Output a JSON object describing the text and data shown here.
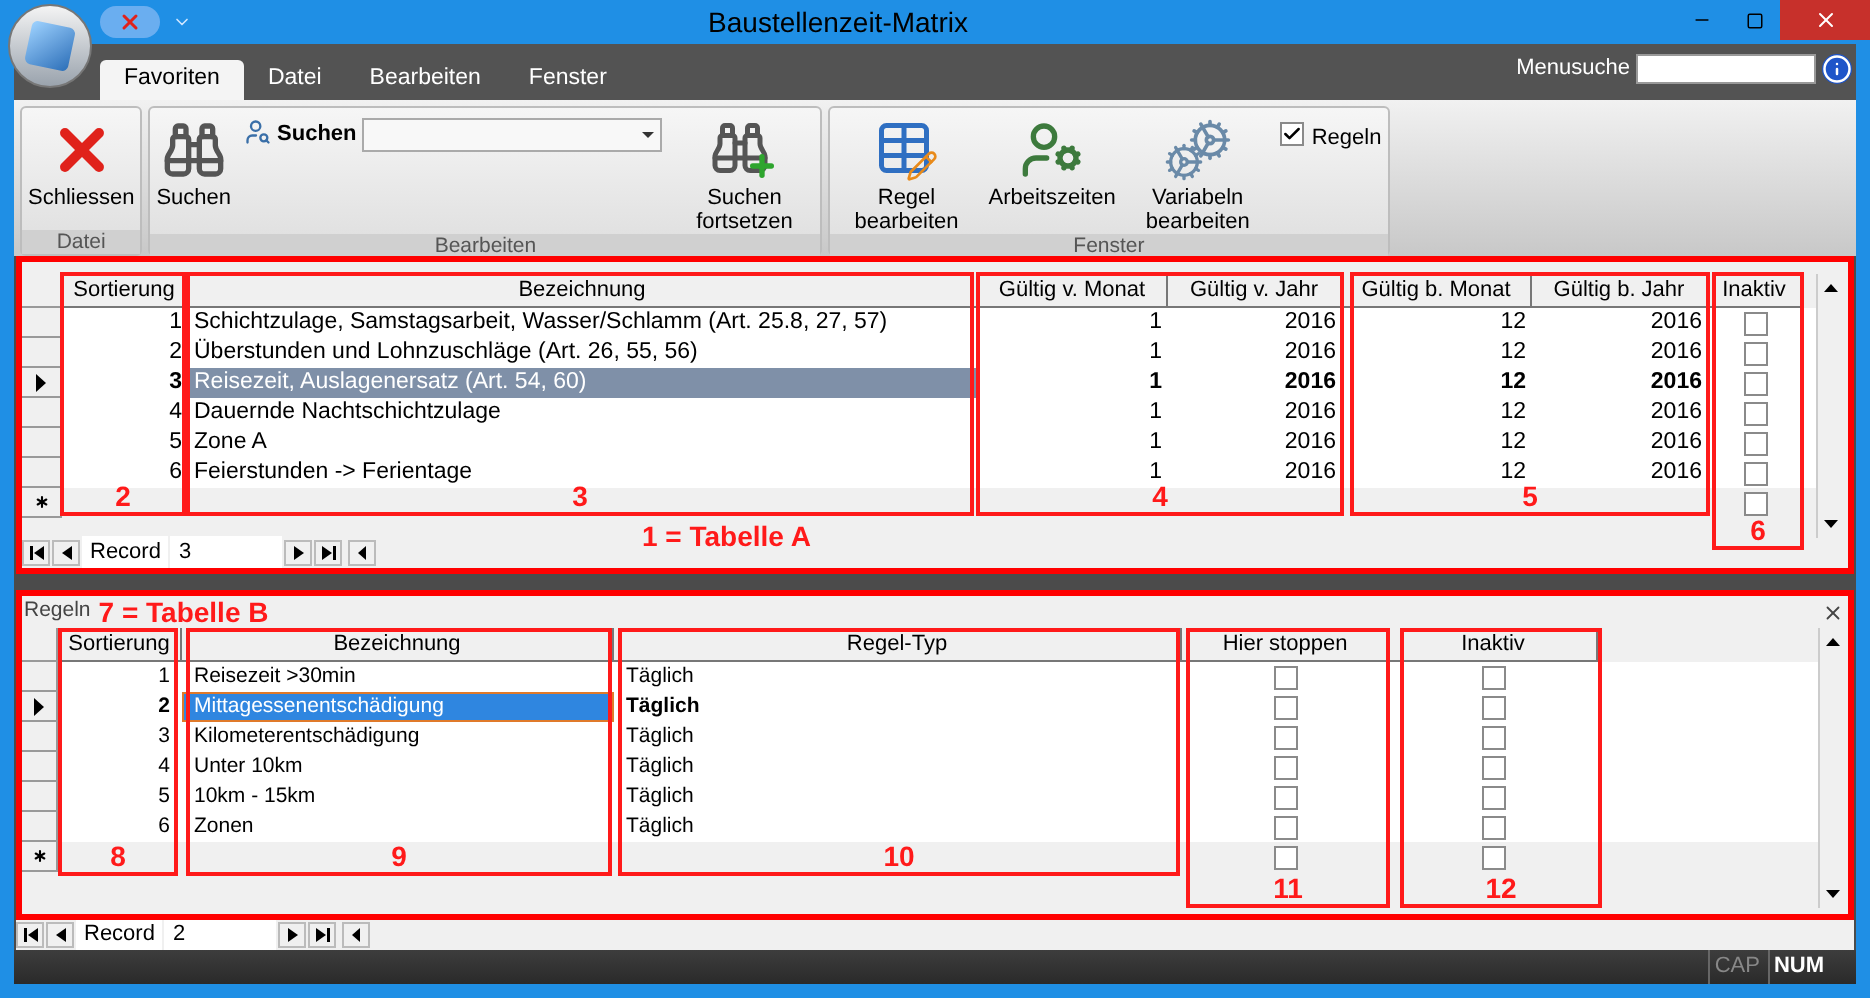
{
  "window": {
    "title": "Baustellenzeit-Matrix"
  },
  "tabs": [
    {
      "label": "Favoriten",
      "selected": true
    },
    {
      "label": "Datei",
      "selected": false
    },
    {
      "label": "Bearbeiten",
      "selected": false
    },
    {
      "label": "Fenster",
      "selected": false
    }
  ],
  "menu_search": {
    "label": "Menusuche"
  },
  "ribbon": {
    "groups": [
      {
        "label": "Datei",
        "items": [
          {
            "kind": "close",
            "label": "Schliessen"
          }
        ]
      },
      {
        "label": "Bearbeiten",
        "items": [
          {
            "kind": "find",
            "label": "Suchen"
          },
          {
            "kind": "combo",
            "label": "Suchen"
          },
          {
            "kind": "find_next",
            "label": "Suchen fortsetzen"
          }
        ]
      },
      {
        "label": "Fenster",
        "items": [
          {
            "kind": "rule",
            "label": "Regel bearbeiten"
          },
          {
            "kind": "hours",
            "label": "Arbeitszeiten"
          },
          {
            "kind": "vars",
            "label": "Variabeln bearbeiten"
          },
          {
            "kind": "checkbox",
            "label": "Regeln",
            "checked": true
          }
        ]
      }
    ]
  },
  "table_a": {
    "title": "1 = Tabelle A",
    "columns": [
      {
        "label": "Sortierung",
        "kind": "number"
      },
      {
        "label": "Bezeichnung",
        "kind": "text"
      },
      {
        "label": "Gültig v. Monat",
        "kind": "number"
      },
      {
        "label": "Gültig v. Jahr",
        "kind": "number"
      },
      {
        "label": "Gültig b. Monat",
        "kind": "number"
      },
      {
        "label": "Gültig b. Jahr",
        "kind": "number"
      },
      {
        "label": "Inaktiv",
        "kind": "checkbox"
      }
    ],
    "rows": [
      {
        "selected": false,
        "cells": [
          {
            "text": "1"
          },
          {
            "text": "Schichtzulage, Samstagsarbeit, Wasser/Schlamm (Art. 25.8, 27, 57)"
          },
          {
            "text": "1"
          },
          {
            "text": "2016"
          },
          {
            "text": "12"
          },
          {
            "text": "2016"
          },
          {
            "checked": false
          }
        ]
      },
      {
        "selected": false,
        "cells": [
          {
            "text": "2"
          },
          {
            "text": "Überstunden und Lohnzuschläge (Art. 26, 55, 56)"
          },
          {
            "text": "1"
          },
          {
            "text": "2016"
          },
          {
            "text": "12"
          },
          {
            "text": "2016"
          },
          {
            "checked": false
          }
        ]
      },
      {
        "selected": true,
        "cells": [
          {
            "text": "3"
          },
          {
            "text": "Reisezeit, Auslagenersatz (Art. 54, 60)"
          },
          {
            "text": "1"
          },
          {
            "text": "2016"
          },
          {
            "text": "12"
          },
          {
            "text": "2016"
          },
          {
            "checked": false
          }
        ]
      },
      {
        "selected": false,
        "cells": [
          {
            "text": "4"
          },
          {
            "text": "Dauernde Nachtschichtzulage"
          },
          {
            "text": "1"
          },
          {
            "text": "2016"
          },
          {
            "text": "12"
          },
          {
            "text": "2016"
          },
          {
            "checked": false
          }
        ]
      },
      {
        "selected": false,
        "cells": [
          {
            "text": "5"
          },
          {
            "text": "Zone A"
          },
          {
            "text": "1"
          },
          {
            "text": "2016"
          },
          {
            "text": "12"
          },
          {
            "text": "2016"
          },
          {
            "checked": false
          }
        ]
      },
      {
        "selected": false,
        "cells": [
          {
            "text": "6"
          },
          {
            "text": "Feierstunden -> Ferientage"
          },
          {
            "text": "1"
          },
          {
            "text": "2016"
          },
          {
            "text": "12"
          },
          {
            "text": "2016"
          },
          {
            "checked": false
          }
        ]
      }
    ],
    "new_row": {
      "checkboxes": [
        {
          "checked": false
        }
      ]
    },
    "annotations": [
      "2",
      "3",
      "4",
      "5",
      "6"
    ],
    "record": {
      "label": "Record",
      "value": "3"
    }
  },
  "table_b": {
    "caption": "Regeln",
    "title": "7 = Tabelle B",
    "columns": [
      {
        "label": "Sortierung",
        "kind": "number"
      },
      {
        "label": "Bezeichnung",
        "kind": "text"
      },
      {
        "label": "Regel-Typ",
        "kind": "text"
      },
      {
        "label": "Hier stoppen",
        "kind": "checkbox"
      },
      {
        "label": "Inaktiv",
        "kind": "checkbox"
      }
    ],
    "rows": [
      {
        "selected": false,
        "cells": [
          {
            "text": "1"
          },
          {
            "text": "Reisezeit >30min"
          },
          {
            "text": "Täglich"
          },
          {
            "checked": false
          },
          {
            "checked": false
          }
        ]
      },
      {
        "selected": true,
        "cells": [
          {
            "text": "2"
          },
          {
            "text": "Mittagessenentschädigung"
          },
          {
            "text": "Täglich"
          },
          {
            "checked": false
          },
          {
            "checked": false
          }
        ]
      },
      {
        "selected": false,
        "cells": [
          {
            "text": "3"
          },
          {
            "text": "Kilometerentschädigung"
          },
          {
            "text": "Täglich"
          },
          {
            "checked": false
          },
          {
            "checked": false
          }
        ]
      },
      {
        "selected": false,
        "cells": [
          {
            "text": "4"
          },
          {
            "text": "Unter 10km"
          },
          {
            "text": "Täglich"
          },
          {
            "checked": false
          },
          {
            "checked": false
          }
        ]
      },
      {
        "selected": false,
        "cells": [
          {
            "text": "5"
          },
          {
            "text": "10km - 15km"
          },
          {
            "text": "Täglich"
          },
          {
            "checked": false
          },
          {
            "checked": false
          }
        ]
      },
      {
        "selected": false,
        "cells": [
          {
            "text": "6"
          },
          {
            "text": "Zonen"
          },
          {
            "text": "Täglich"
          },
          {
            "checked": false
          },
          {
            "checked": false
          }
        ]
      }
    ],
    "new_row": {
      "checkboxes": [
        {
          "checked": false
        },
        {
          "checked": false
        }
      ]
    },
    "annotations": [
      "8",
      "9",
      "10",
      "11",
      "12"
    ],
    "record": {
      "label": "Record",
      "value": "2"
    }
  },
  "status_bar": {
    "indicators": [
      {
        "label": "CAP",
        "on": false
      },
      {
        "label": "NUM",
        "on": true
      }
    ]
  }
}
